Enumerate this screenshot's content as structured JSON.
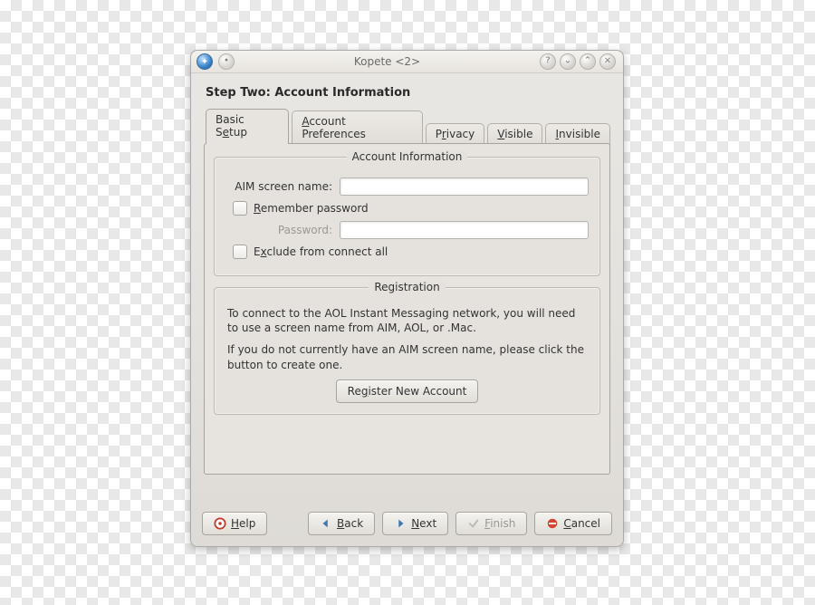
{
  "window": {
    "title": "Kopete <2>"
  },
  "heading": "Step Two: Account Information",
  "tabs": [
    {
      "label_pre": "Basic S",
      "mnemonic": "e",
      "label_post": "tup",
      "selected": true
    },
    {
      "label_pre": "",
      "mnemonic": "A",
      "label_post": "ccount Preferences",
      "selected": false
    },
    {
      "label_pre": "P",
      "mnemonic": "r",
      "label_post": "ivacy",
      "selected": false
    },
    {
      "label_pre": "",
      "mnemonic": "V",
      "label_post": "isible",
      "selected": false
    },
    {
      "label_pre": "",
      "mnemonic": "I",
      "label_post": "nvisible",
      "selected": false
    }
  ],
  "group_account": {
    "legend": "Account Information",
    "screen_name": {
      "label_pre": "AIM ",
      "mnemonic": "s",
      "label_post": "creen name:",
      "value": ""
    },
    "remember_pw": {
      "label_pre": "",
      "mnemonic": "R",
      "label_post": "emember password",
      "checked": false
    },
    "password": {
      "label": "Password:",
      "value": "",
      "enabled": false
    },
    "exclude_all": {
      "label_pre": "E",
      "mnemonic": "x",
      "label_post": "clude from connect all",
      "checked": false
    }
  },
  "group_registration": {
    "legend": "Registration",
    "p1": "To connect to the AOL Instant Messaging network, you will need to use a screen name from AIM, AOL, or .Mac.",
    "p2": "If you do not currently have an AIM screen name, please click the button to create one.",
    "button": {
      "label_pre": "Re",
      "mnemonic": "g",
      "label_post": "ister New Account"
    }
  },
  "buttons": {
    "help": {
      "label_pre": "",
      "mnemonic": "H",
      "label_post": "elp"
    },
    "back": {
      "label_pre": "",
      "mnemonic": "B",
      "label_post": "ack"
    },
    "next": {
      "label_pre": "",
      "mnemonic": "N",
      "label_post": "ext"
    },
    "finish": {
      "label_pre": "",
      "mnemonic": "F",
      "label_post": "inish",
      "enabled": false
    },
    "cancel": {
      "label_pre": "",
      "mnemonic": "C",
      "label_post": "ancel"
    }
  }
}
